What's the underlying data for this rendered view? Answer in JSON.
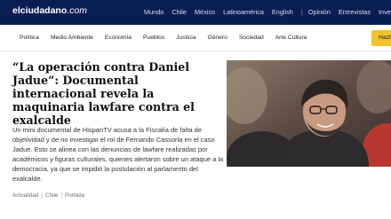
{
  "topbar": {
    "logo": {
      "bold": "elciudadano",
      "italic": ".com"
    },
    "nav": [
      "Mundo",
      "Chile",
      "México",
      "Latinoamérica",
      "English"
    ],
    "separator": "|",
    "nav2": [
      "Opinión",
      "Entrevistas",
      "Investigación"
    ]
  },
  "secnav": {
    "items": [
      "Política",
      "Medio Ambiente",
      "Economía",
      "Pueblos",
      "Justicia",
      "Género",
      "Sociedad",
      "Arte Cultura"
    ],
    "button_label": "Hazte"
  },
  "article": {
    "title": "“La operación contra Daniel Jadue”: Documental internacional revela la maquinaria lawfare contra el exalcalde",
    "lead": "Un mini documental de HispanTV acusa a la Fiscalía de falta de objetividad y de no investigar el rol de Fernando Cassorla en el caso Jadue. Esto se alinea con las denuncias de lawfare realizadas por académicos y figuras culturales, quienes alertaron sobre un ataque a la democracia, ya que se impidió la postulación al parlamento del exalcalde.",
    "meta": [
      "Actualidad",
      "Chile",
      "Portada"
    ],
    "meta_separator": "|"
  },
  "colors": {
    "topbar": "#0b1e54",
    "button": "#f2c12e"
  }
}
